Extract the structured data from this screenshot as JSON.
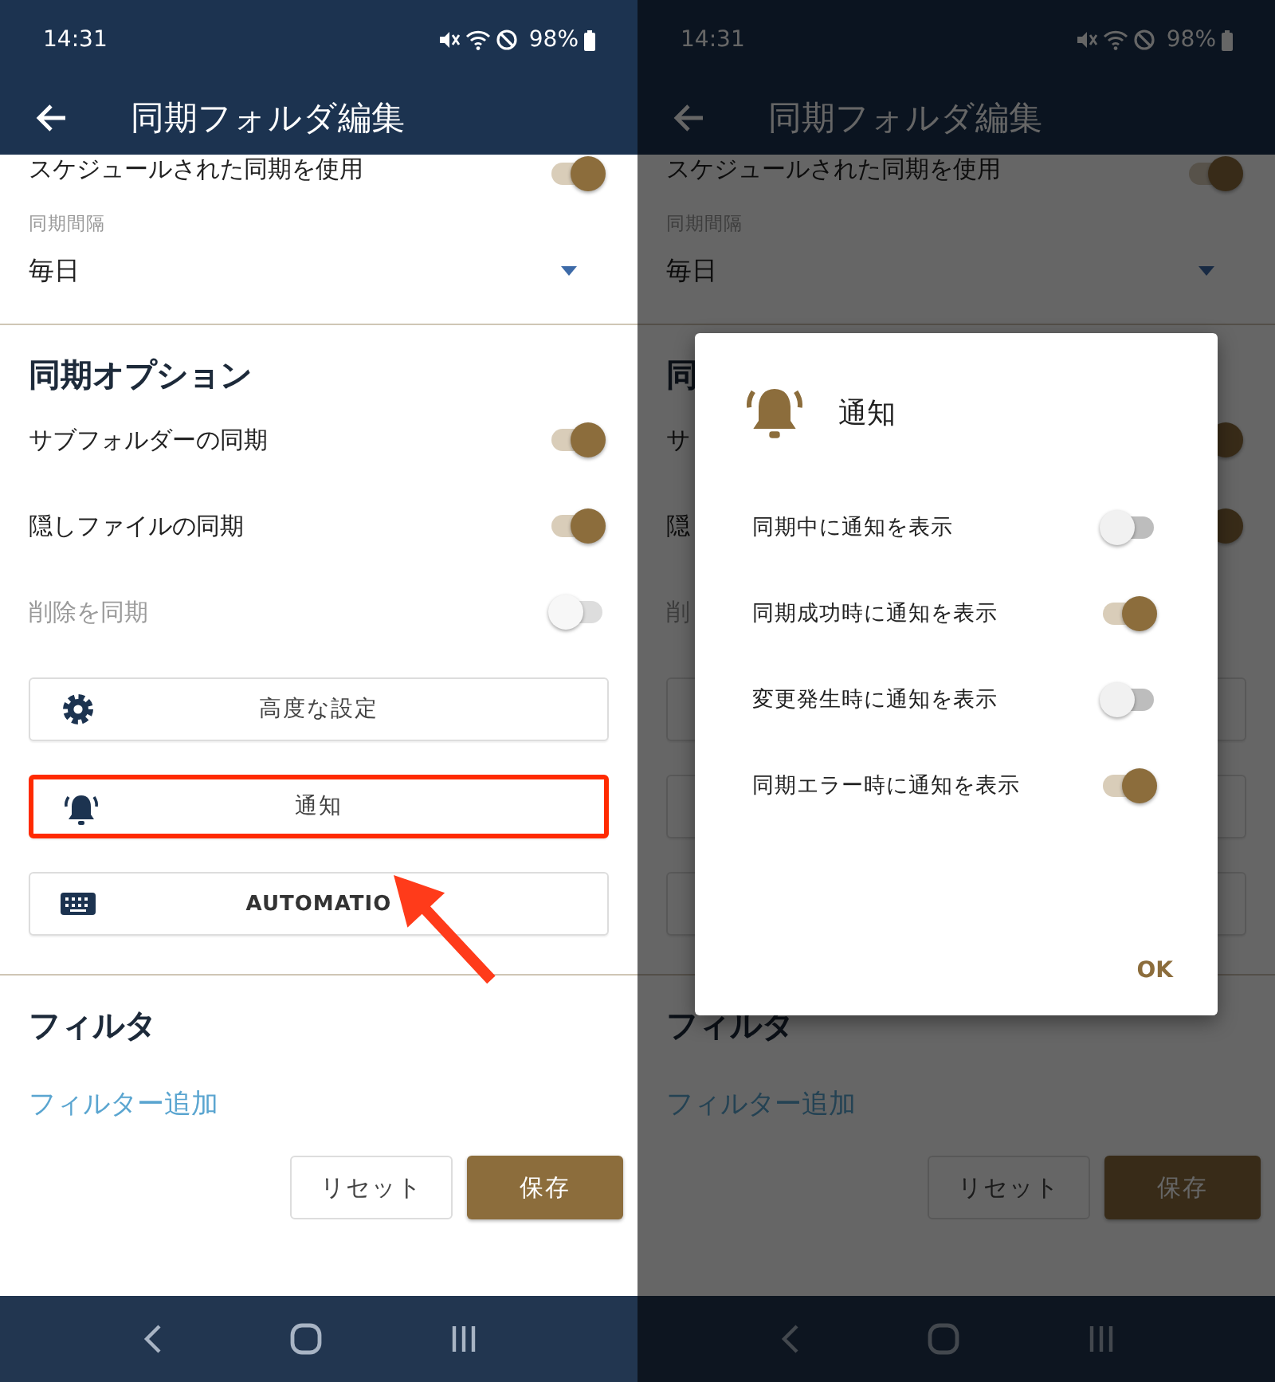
{
  "phones": [
    {
      "dimmed": false,
      "pointer_arrow": true,
      "status_bar": {
        "time": "14:31",
        "battery": "98%"
      },
      "app_bar": {
        "title": "同期フォルダ編集"
      },
      "schedule": {
        "label": "スケジュールされた同期を使用",
        "on": true
      },
      "interval": {
        "label": "同期間隔",
        "value": "毎日"
      },
      "options_section": {
        "title": "同期オプション",
        "toggles": [
          {
            "label": "サブフォルダーの同期",
            "on": true,
            "disabled": false
          },
          {
            "label": "隠しファイルの同期",
            "on": true,
            "disabled": false
          },
          {
            "label": "削除を同期",
            "on": false,
            "disabled": true
          }
        ],
        "action_buttons": [
          {
            "kind": "gear",
            "label": "高度な設定",
            "highlighted": false
          },
          {
            "kind": "bell",
            "label": "通知",
            "highlighted": true
          },
          {
            "kind": "keyboard",
            "label": "AUTOMATIO",
            "highlighted": false
          }
        ]
      },
      "filter_section": {
        "title": "フィルタ",
        "add_link": "フィルター追加"
      },
      "footer_buttons": [
        {
          "kind": "outline",
          "label": "リセット"
        },
        {
          "kind": "filled",
          "label": "保存"
        }
      ]
    },
    {
      "dimmed": true,
      "pointer_arrow": false,
      "status_bar": {
        "time": "14:31",
        "battery": "98%"
      },
      "app_bar": {
        "title": "同期フォルダ編集"
      },
      "schedule": {
        "label": "スケジュールされた同期を使用",
        "on": true
      },
      "interval": {
        "label": "同期間隔",
        "value": "毎日"
      },
      "options_section": {
        "title": "同",
        "toggles": [
          {
            "label": "サ",
            "on": true,
            "disabled": false
          },
          {
            "label": "隠",
            "on": true,
            "disabled": false
          },
          {
            "label": "削",
            "disabled": true
          }
        ],
        "action_buttons": [
          {
            "kind": "blank",
            "highlighted": false
          },
          {
            "kind": "blank",
            "highlighted": false
          },
          {
            "kind": "blank",
            "highlighted": false
          }
        ]
      },
      "filter_section": {
        "title": "フィルタ",
        "add_link": "フィルター追加"
      },
      "footer_buttons": [
        {
          "kind": "outline",
          "label": "リセット"
        },
        {
          "kind": "filled",
          "label": "保存"
        }
      ],
      "dialog": {
        "title": "通知",
        "toggles": [
          {
            "label": "同期中に通知を表示",
            "on": false
          },
          {
            "label": "同期成功時に通知を表示",
            "on": true
          },
          {
            "label": "変更発生時に通知を表示",
            "on": false
          },
          {
            "label": "同期エラー時に通知を表示",
            "on": true
          }
        ],
        "ok": "OK"
      }
    }
  ]
}
